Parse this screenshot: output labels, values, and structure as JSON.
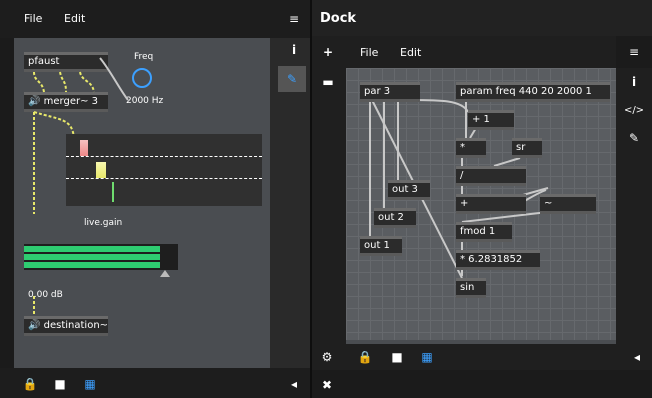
{
  "left": {
    "menu": {
      "file": "File",
      "edit": "Edit"
    },
    "objects": {
      "pfaust": "pfaust",
      "merger": "merger~ 3",
      "freq_label": "Freq",
      "freq_value": "2000 Hz",
      "live_gain": "live.gain",
      "db_value": "0.00 dB",
      "destination": "destination~"
    },
    "bottom_icons": [
      "lock-icon",
      "camera-icon",
      "grid-icon",
      "speaker-icon"
    ]
  },
  "dock": {
    "title": "Dock",
    "menu": {
      "file": "File",
      "edit": "Edit"
    },
    "objects": {
      "par3": "par 3",
      "param": "param freq 440 20 2000 1",
      "plus1": "+ 1",
      "mul": "*",
      "sr": "sr",
      "div": "/",
      "add": "+",
      "tilde": "~",
      "fmod": "fmod 1",
      "mul2pi": "* 6.2831852",
      "sin": "sin",
      "out1": "out 1",
      "out2": "out 2",
      "out3": "out 3"
    }
  },
  "colors": {
    "accent": "#3ca0ff",
    "meter_green": "#2ecc71",
    "cable_yellow": "#e8e86a",
    "cable_grey": "#c8c8c8"
  }
}
